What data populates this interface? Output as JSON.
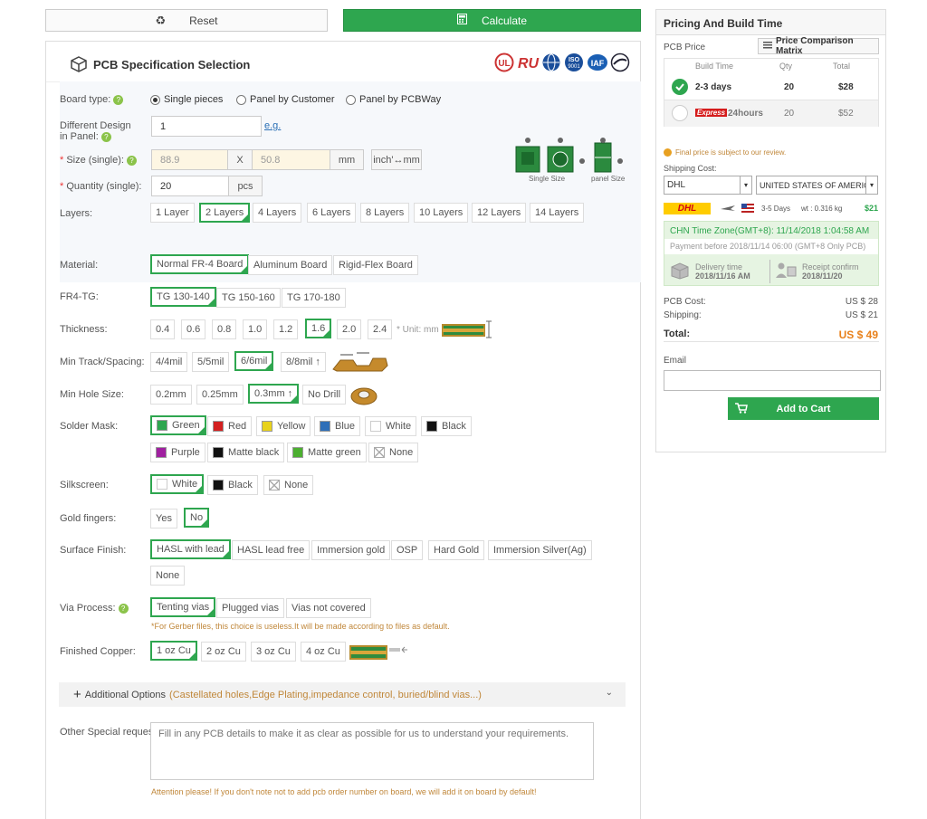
{
  "toolbar": {
    "reset_label": "Reset",
    "calculate_label": "Calculate"
  },
  "form": {
    "title": "PCB Specification Selection",
    "board_type": {
      "label": "Board type:",
      "options": [
        "Single pieces",
        "Panel by Customer",
        "Panel by PCBWay"
      ],
      "selected": "Single pieces"
    },
    "different_design": {
      "label1": "Different Design",
      "label2": "in Panel:",
      "value": "1",
      "eg": "e.g."
    },
    "size": {
      "label": "Size (single):",
      "x_value": "88.9",
      "sep": "X",
      "y_value": "50.8",
      "unit": "mm",
      "convert": "inch'↔mm",
      "single_caption": "Single Size",
      "panel_caption": "panel Size"
    },
    "quantity": {
      "label": "Quantity (single):",
      "value": "20",
      "unit": "pcs"
    },
    "layers": {
      "label": "Layers:",
      "options": [
        "1 Layer",
        "2 Layers",
        "4 Layers",
        "6 Layers",
        "8 Layers",
        "10 Layers",
        "12 Layers",
        "14 Layers"
      ]
    },
    "material": {
      "label": "Material:",
      "options": [
        "Normal FR-4 Board",
        "Aluminum Board",
        "Rigid-Flex Board"
      ]
    },
    "fr4tg": {
      "label": "FR4-TG:",
      "options": [
        "TG 130-140",
        "TG 150-160",
        "TG 170-180"
      ]
    },
    "thickness": {
      "label": "Thickness:",
      "options": [
        "0.4",
        "0.6",
        "0.8",
        "1.0",
        "1.2",
        "1.6",
        "2.0",
        "2.4"
      ],
      "unit_note": "* Unit: mm"
    },
    "track": {
      "label": "Min Track/Spacing:",
      "options": [
        "4/4mil",
        "5/5mil",
        "6/6mil",
        "8/8mil ↑"
      ]
    },
    "hole": {
      "label": "Min Hole Size:",
      "options": [
        "0.2mm",
        "0.25mm",
        "0.3mm ↑",
        "No Drill"
      ]
    },
    "solder": {
      "label": "Solder Mask:",
      "options": [
        "Green",
        "Red",
        "Yellow",
        "Blue",
        "White",
        "Black",
        "Purple",
        "Matte black",
        "Matte green",
        "None"
      ]
    },
    "silk": {
      "label": "Silkscreen:",
      "options": [
        "White",
        "Black",
        "None"
      ]
    },
    "gold": {
      "label": "Gold fingers:",
      "options": [
        "Yes",
        "No"
      ]
    },
    "surface": {
      "label": "Surface Finish:",
      "options": [
        "HASL with lead",
        "HASL lead free",
        "Immersion gold",
        "OSP",
        "Hard Gold",
        "Immersion Silver(Ag)",
        "None"
      ]
    },
    "via": {
      "label": "Via Process:",
      "options": [
        "Tenting vias",
        "Plugged vias",
        "Vias not covered"
      ],
      "note": "*For Gerber files, this choice is useless.It will be made according to files as default."
    },
    "copper": {
      "label": "Finished Copper:",
      "options": [
        "1 oz Cu",
        "2 oz Cu",
        "3 oz Cu",
        "4 oz Cu"
      ]
    },
    "additional": {
      "label": "Additional Options",
      "detail": "(Castellated holes,Edge Plating,impedance control, buried/blind vias...)"
    },
    "special": {
      "label": "Other Special request:",
      "placeholder": "Fill in any PCB details to make it as clear as possible for us to understand your requirements.",
      "attention": "Attention please! If you don't note not to add pcb order number on board, we will add it on board by default!"
    }
  },
  "sidebar": {
    "title": "Pricing And Build Time",
    "pcb_price": "PCB Price",
    "matrix_button": "Price Comparison Matrix",
    "headers": [
      "Build Time",
      "Qty",
      "Total"
    ],
    "rows": [
      {
        "time": "2-3 days",
        "qty": "20",
        "total": "$28"
      },
      {
        "badge": "Express",
        "time": "24hours",
        "qty": "20",
        "total": "$52"
      }
    ],
    "final_note": "Final price is subject to our review.",
    "shipping_label": "Shipping Cost:",
    "carrier": "DHL",
    "country": "UNITED STATES OF AMERICA",
    "ship_days": "3-5 Days",
    "ship_weight": "wt : 0.316 kg",
    "ship_price": "$21",
    "carrier_logo": "DHL",
    "timezone": "CHN Time Zone(GMT+8): 11/14/2018 1:04:58 AM",
    "payment_before": "Payment before 2018/11/14 06:00 (GMT+8 Only PCB)",
    "delivery_label": "Delivery time",
    "delivery_date": "2018/11/16 AM",
    "receipt_label": "Receipt confirm",
    "receipt_date": "2018/11/20",
    "pcb_cost_label": "PCB Cost:",
    "pcb_cost": "US $ 28",
    "shipping_label2": "Shipping:",
    "shipping_cost": "US $ 21",
    "total_label": "Total:",
    "total": "US $ 49",
    "email_label": "Email",
    "add_to_cart": "Add to Cart"
  },
  "colors": {
    "accent": "#2ea64f",
    "orange": "#e8801a",
    "note": "#c0873a"
  }
}
